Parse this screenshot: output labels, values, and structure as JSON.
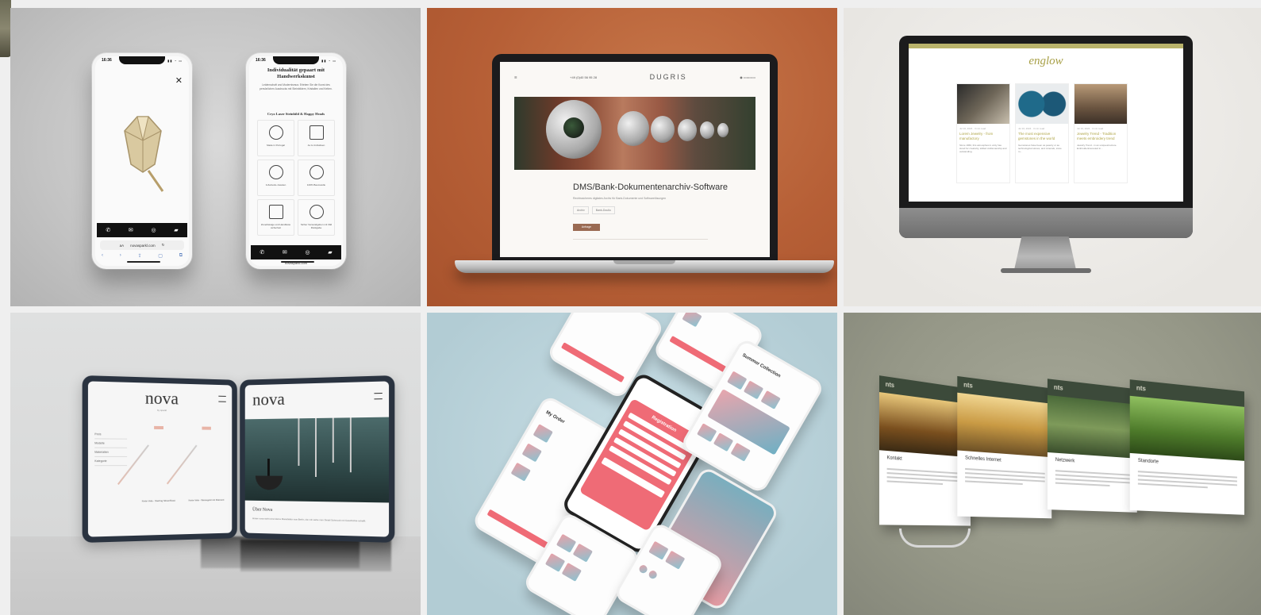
{
  "tiles": [
    {
      "id": "phones-jewelry"
    },
    {
      "id": "laptop-dms"
    },
    {
      "id": "imac-englow"
    },
    {
      "id": "tablets-nova"
    },
    {
      "id": "phones-shoes"
    },
    {
      "id": "monitors-nts"
    }
  ],
  "phone_jewelry": {
    "time_left": "16:36",
    "time_right": "16:36",
    "url": "novasparkl.com",
    "url_short": "novasparkl.com",
    "heading": "Individualität gepaart mit Handwerkskunst",
    "paragraph": "Leidenschaft und Modernismus: Erleben Sie die Kunst des persönlichen Ausdrucks mit Steinbildern, Kristallen und Ketten.",
    "subheading": "Cryo Laser Steinbild & Happy Heads",
    "features": [
      "Made in Portugal",
      "Ja zu Individuen",
      "3-Zelnetto-Juwelen",
      "100% Baumwolle",
      "Zuverlässige und Handfeste sicherheit",
      "Sicher Versandgeben mit 30d Rückgabe"
    ]
  },
  "laptop_dms": {
    "phone": "+49 (0)40 56 95 28",
    "logo": "DUGRIS",
    "title": "DMS/Bank-Dokumentenarchiv-Software",
    "subtitle": "Rechtssicheres digitales Archiv für Bank-Dokumente und Softwarelösungen",
    "tags": [
      "Archiv",
      "Bank-Doulio"
    ],
    "button": "Anfrage"
  },
  "imac_englow": {
    "logo": "englow",
    "cards": [
      {
        "meta": "Jul 16, 2024 · 3 min read",
        "title": "Lorem Jewelry - from manufactory",
        "text": "Since 1960, this atmosphere's unity has stood for creativity, skilled craftsmanship and outstanding."
      },
      {
        "meta": "Jul 16, 2024 · 3 min read",
        "title": "The most expensive gemstones in the world",
        "text": "Gemstones have been as jewelry or as technological stones, and minerals, since m..."
      },
      {
        "meta": "Jul 16, 2024 · 3 min read",
        "title": "Jewelry Trend - Tradition meets embroidery trend",
        "text": "Jewelry Trend - in an uniquestructure. Embroiderinterested in..."
      }
    ]
  },
  "tablets_nova": {
    "logo_left": "nova",
    "logo_right": "nova",
    "tagline": "by sparkl",
    "filters": [
      "Preis",
      "Modelle",
      "Materialien",
      "Kategorie"
    ],
    "products": [
      {
        "name": "Kette Vela - Sterling Silver/Rosé",
        "price": "€89,90"
      },
      {
        "name": "Kette Vela - Weissgold mit Diamant",
        "price": "€89,90"
      }
    ],
    "story_heading": "Über Nova",
    "story_text": "Hinter nova steht eine kleine Manufaktur aus Berlin, die mit Liebe zum Detail Schmuck mit Geschichte schafft."
  },
  "phones_shoes": {
    "my_order": "My Order",
    "registration": "Registration",
    "summer": "Summer Collection"
  },
  "monitors_nts": {
    "brand": "nts",
    "panels": [
      "Kontakt",
      "Schnelles Internet",
      "Netzwerk",
      "Standorte"
    ]
  },
  "colors": {
    "accent_orange": "#b65f36",
    "englow_gold": "#a8a047",
    "shoe_pink": "#ef6b76",
    "nts_green": "#3c4a3a"
  }
}
